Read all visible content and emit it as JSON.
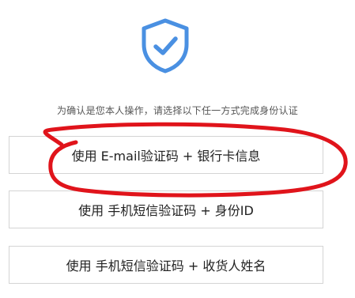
{
  "icon": {
    "name": "shield-check-icon",
    "color": "#4a90e2"
  },
  "prompt": "为确认是您本人操作，请选择以下任一方式完成身份认证",
  "options": [
    {
      "label": "使用 E-mail验证码 + 银行卡信息"
    },
    {
      "label": "使用 手机短信验证码 + 身份ID"
    },
    {
      "label": "使用 手机短信验证码 + 收货人姓名"
    }
  ],
  "annotation": {
    "color": "#e0141b"
  }
}
